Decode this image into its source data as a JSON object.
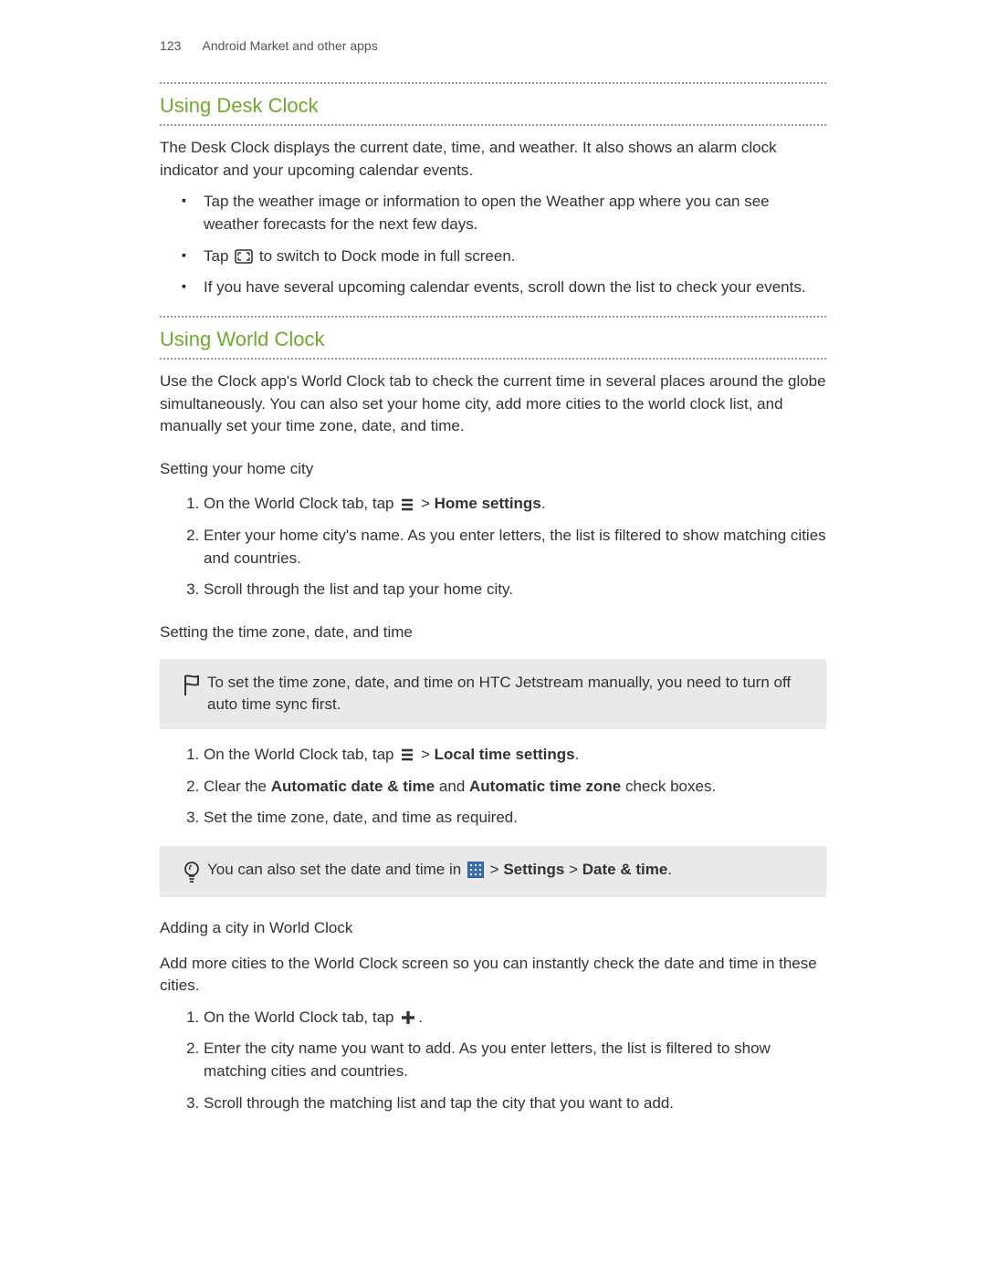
{
  "header": {
    "page_number": "123",
    "chapter": "Android Market and other apps"
  },
  "s1": {
    "title": "Using Desk Clock",
    "intro": "The Desk Clock displays the current date, time, and weather. It also shows an alarm clock indicator and your upcoming calendar events.",
    "b1": "Tap the weather image or information to open the Weather app where you can see weather forecasts for the next few days.",
    "b2a": "Tap",
    "b2b": "to switch to Dock mode in full screen.",
    "b3": "If you have several upcoming calendar events, scroll down the list to check your events."
  },
  "s2": {
    "title": "Using World Clock",
    "intro": "Use the Clock app's World Clock tab to check the current time in several places around the globe simultaneously. You can also set your home city, add more cities to the world clock list, and manually set your time zone, date, and time.",
    "home": {
      "title": "Setting your home city",
      "n1a": "On the World Clock tab, tap",
      "n1b": " > ",
      "n1c": "Home settings",
      "n1d": ".",
      "n2": "Enter your home city's name. As you enter letters, the list is filtered to show matching cities and countries.",
      "n3": "Scroll through the list and tap your home city."
    },
    "tz": {
      "title": "Setting the time zone, date, and time",
      "flag_note": "To set the time zone, date, and time on HTC Jetstream manually, you need to turn off auto time sync first.",
      "n1a": "On the World Clock tab, tap",
      "n1b": " > ",
      "n1c": "Local time settings",
      "n1d": ".",
      "n2a": "Clear the ",
      "n2b": "Automatic date & time",
      "n2c": " and ",
      "n2d": "Automatic time zone",
      "n2e": " check boxes.",
      "n3": "Set the time zone, date, and time as required.",
      "tip_a": "You can also set the date and time in",
      "tip_b": " > ",
      "tip_c": "Settings",
      "tip_d": " > ",
      "tip_e": "Date & time",
      "tip_f": "."
    },
    "add": {
      "title": "Adding a city in World Clock",
      "intro": "Add more cities to the World Clock screen so you can instantly check the date and time in these cities.",
      "n1a": "On the World Clock tab, tap",
      "n1b": ".",
      "n2": "Enter the city name you want to add. As you enter letters, the list is filtered to show matching cities and countries.",
      "n3": "Scroll through the matching list and tap the city that you want to add."
    }
  }
}
